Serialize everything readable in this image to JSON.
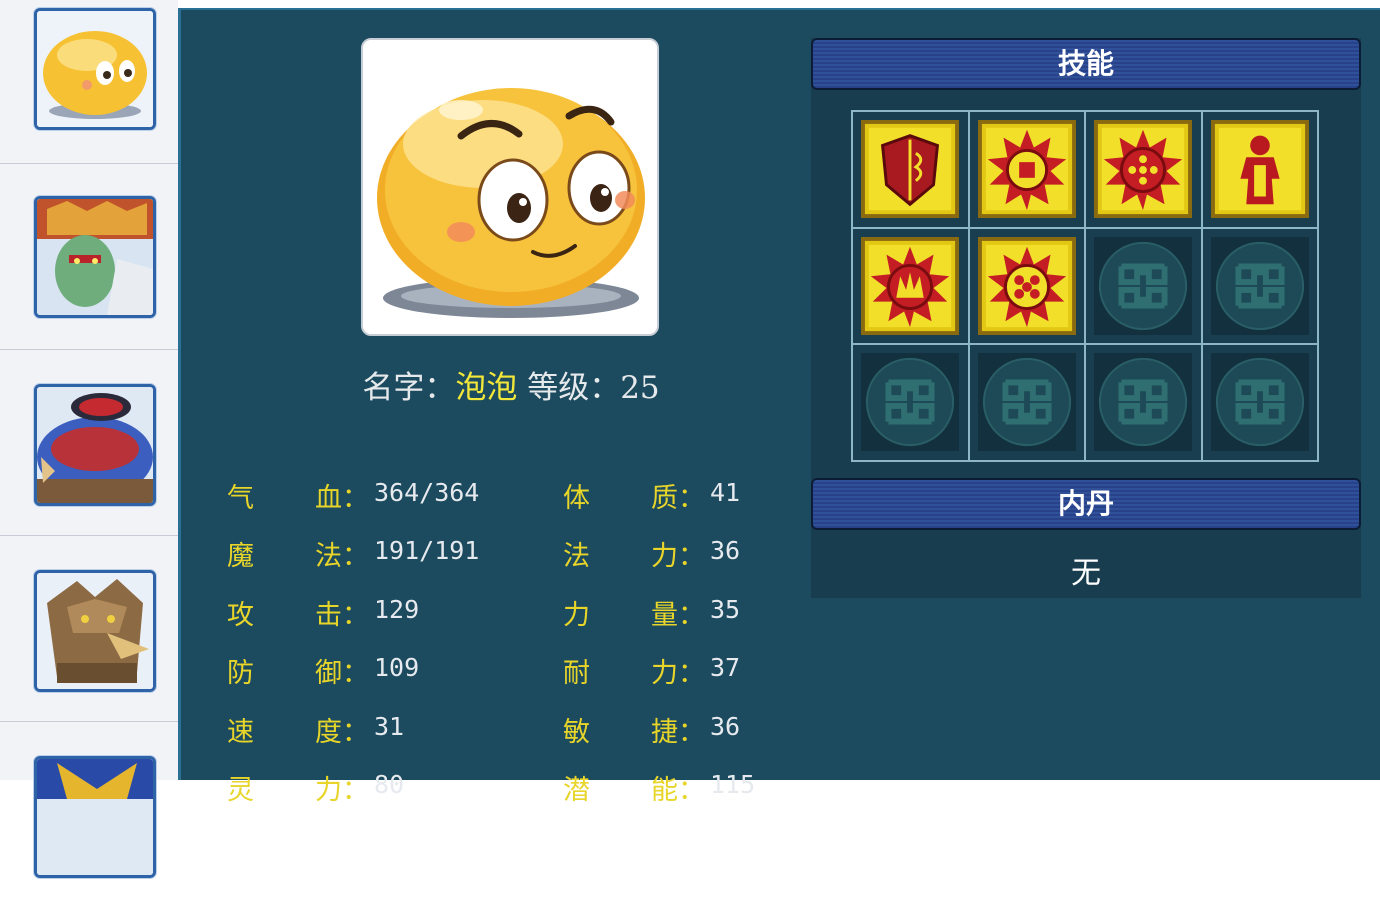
{
  "sidebar": {
    "pets": [
      {
        "name": "bubble-pet-thumb",
        "selected": true
      },
      {
        "name": "demon-warrior-thumb"
      },
      {
        "name": "feather-creature-thumb"
      },
      {
        "name": "eagle-beast-thumb"
      },
      {
        "name": "blue-gold-pet-thumb"
      }
    ]
  },
  "pet": {
    "name_label": "名字：",
    "name": "泡泡",
    "level_label": "等级：",
    "level": "25"
  },
  "stats": [
    {
      "c1": "气",
      "c2": "血：",
      "value": "364/364"
    },
    {
      "c1": "魔",
      "c2": "法：",
      "value": "191/191"
    },
    {
      "c1": "攻",
      "c2": "击：",
      "value": "129"
    },
    {
      "c1": "防",
      "c2": "御：",
      "value": "109"
    },
    {
      "c1": "速",
      "c2": "度：",
      "value": "31"
    },
    {
      "c1": "灵",
      "c2": "力：",
      "value": "80"
    },
    {
      "c1": "体",
      "c2": "质：",
      "value": "41"
    },
    {
      "c1": "法",
      "c2": "力：",
      "value": "36"
    },
    {
      "c1": "力",
      "c2": "量：",
      "value": "35"
    },
    {
      "c1": "耐",
      "c2": "力：",
      "value": "37"
    },
    {
      "c1": "敏",
      "c2": "捷：",
      "value": "36"
    },
    {
      "c1": "潜",
      "c2": "能：",
      "value": "115"
    }
  ],
  "skills": {
    "title": "技能",
    "slots": [
      {
        "icon": "shield-skill-icon",
        "filled": true
      },
      {
        "icon": "sun-skill-icon",
        "filled": true
      },
      {
        "icon": "sun-dots-skill-icon",
        "filled": true
      },
      {
        "icon": "figure-skill-icon",
        "filled": true
      },
      {
        "icon": "sun-crown-skill-icon",
        "filled": true
      },
      {
        "icon": "sun-grid-skill-icon",
        "filled": true
      },
      {
        "icon": "empty-slot-icon",
        "filled": false
      },
      {
        "icon": "empty-slot-icon",
        "filled": false
      },
      {
        "icon": "empty-slot-icon",
        "filled": false
      },
      {
        "icon": "empty-slot-icon",
        "filled": false
      },
      {
        "icon": "empty-slot-icon",
        "filled": false
      },
      {
        "icon": "empty-slot-icon",
        "filled": false
      }
    ]
  },
  "neidan": {
    "title": "内丹",
    "value": "无"
  },
  "colors": {
    "panel_bg": "#1c4a5e",
    "stat_label": "#e8d52a",
    "name_value": "#f3e83a"
  }
}
